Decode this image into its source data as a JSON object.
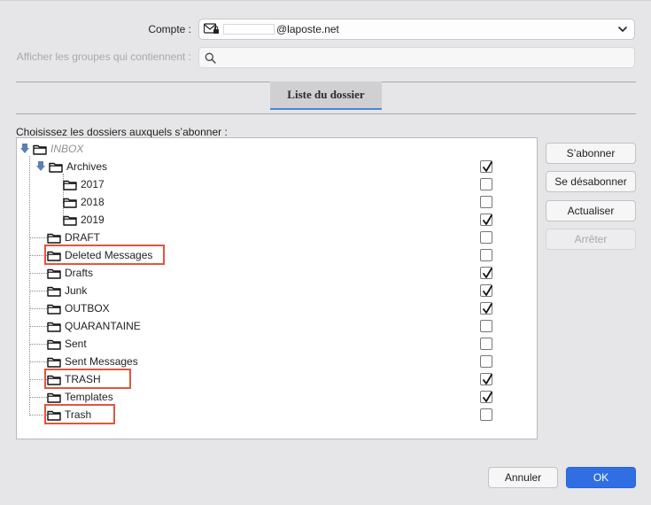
{
  "account": {
    "label": "Compte :",
    "address_suffix": "@laposte.net",
    "icon": "mail-lock-icon"
  },
  "filter": {
    "label": "Afficher les groupes qui contiennent :",
    "value": "",
    "placeholder": "",
    "icon": "search-icon"
  },
  "tabs": [
    {
      "label": "Liste du dossier",
      "active": true
    }
  ],
  "folder_list": {
    "label": "Choisissez les dossiers auxquels s’abonner :",
    "items": [
      {
        "label": "INBOX",
        "checked": null,
        "expanded": true
      },
      {
        "label": "Archives",
        "checked": true,
        "expanded": true
      },
      {
        "label": "2017",
        "checked": false
      },
      {
        "label": "2018",
        "checked": false
      },
      {
        "label": "2019",
        "checked": true
      },
      {
        "label": "DRAFT",
        "checked": false
      },
      {
        "label": "Deleted Messages",
        "checked": false,
        "highlighted": true
      },
      {
        "label": "Drafts",
        "checked": true
      },
      {
        "label": "Junk",
        "checked": true
      },
      {
        "label": "OUTBOX",
        "checked": true
      },
      {
        "label": "QUARANTAINE",
        "checked": false
      },
      {
        "label": "Sent",
        "checked": false
      },
      {
        "label": "Sent Messages",
        "checked": false
      },
      {
        "label": "TRASH",
        "checked": true,
        "highlighted": true
      },
      {
        "label": "Templates",
        "checked": true
      },
      {
        "label": "Trash",
        "checked": false,
        "highlighted": true
      }
    ]
  },
  "side_buttons": {
    "subscribe": "S’abonner",
    "unsubscribe": "Se désabonner",
    "refresh": "Actualiser",
    "stop": "Arrêter"
  },
  "footer": {
    "cancel": "Annuler",
    "ok": "OK"
  },
  "colors": {
    "accent": "#2f6fe3",
    "highlight_box": "#e2553e",
    "tab_underline": "#4a86d8"
  }
}
